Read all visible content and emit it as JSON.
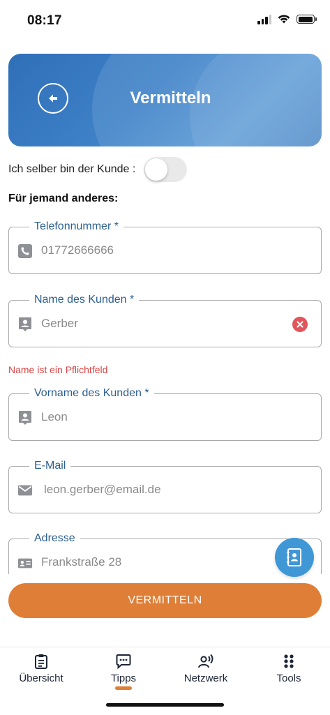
{
  "status_bar": {
    "time": "08:17",
    "icons": [
      "cellular-signal-icon",
      "wifi-icon",
      "battery-icon"
    ]
  },
  "header": {
    "title": "Vermitteln",
    "back_icon": "arrow-left-icon",
    "gradient_colors": [
      "#2f6fb8",
      "#5b9ad6"
    ]
  },
  "self_customer": {
    "label": "Ich selber bin der Kunde :",
    "toggle_on": false
  },
  "section_title": "Für jemand anderes:",
  "fields": {
    "phone": {
      "label": "Telefonnummer *",
      "value": "01772666666",
      "icon": "phone-icon"
    },
    "last_name": {
      "label": "Name des Kunden *",
      "value": "Gerber",
      "icon": "person-badge-icon",
      "clear_icon": "close-circle-icon"
    },
    "last_name_error": "Name ist ein Pflichtfeld",
    "first_name": {
      "label": "Vorname des Kunden *",
      "value": "Leon",
      "icon": "person-badge-icon"
    },
    "email": {
      "label": "E-Mail",
      "value": "leon.gerber@email.de",
      "icon": "mail-icon"
    },
    "address": {
      "label": "Adresse",
      "value": "Frankstraße 28",
      "icon": "id-card-icon"
    }
  },
  "contacts_fab_icon": "contact-book-icon",
  "submit_label": "VERMITTELN",
  "colors": {
    "accent": "#df7f37",
    "label_blue": "#2c5f8f",
    "error": "#d64545",
    "fab_blue": "#3f97d6"
  },
  "bottom_nav": {
    "items": [
      {
        "label": "Übersicht",
        "icon": "clipboard-icon"
      },
      {
        "label": "Tipps",
        "icon": "chat-bubble-icon",
        "active": true
      },
      {
        "label": "Netzwerk",
        "icon": "person-voice-icon"
      },
      {
        "label": "Tools",
        "icon": "grid-dots-icon"
      }
    ]
  }
}
